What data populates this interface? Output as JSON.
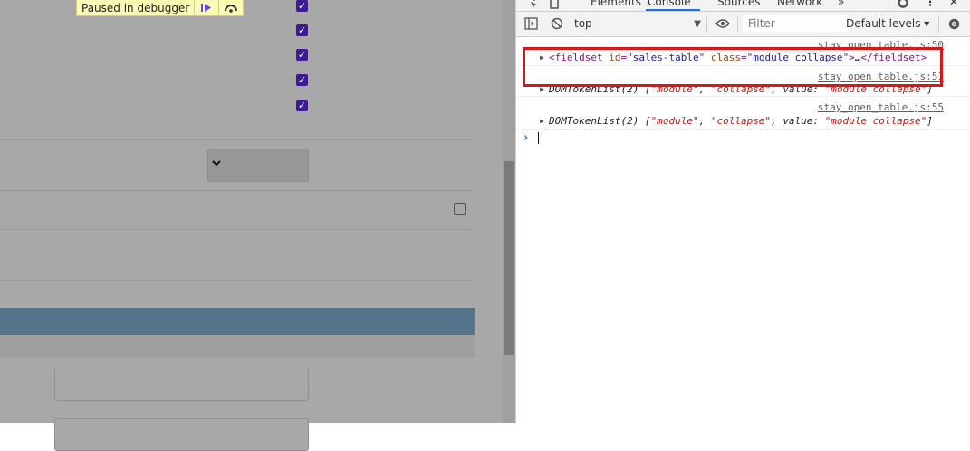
{
  "debugger_banner": {
    "text": "Paused in debugger"
  },
  "devtools": {
    "tabs": [
      "Elements",
      "Console",
      "Sources",
      "Network",
      "»"
    ],
    "active_tab": "Console",
    "context": "top",
    "filter_placeholder": "Filter",
    "levels": "Default levels ▾",
    "logs": [
      {
        "source": "stay_open_table.js:50"
      },
      {
        "source": "stay_open_table.js:51"
      },
      {
        "source": "stay_open_table.js:55"
      }
    ],
    "fieldset": {
      "tag": "fieldset",
      "id_attr": "id",
      "id_val": "sales-table",
      "class_attr": "class",
      "class_val": "module collapse",
      "ellipsis": "…",
      "close_tag": "</fieldset>"
    },
    "tokenlist": {
      "label": "DOMTokenList(2) [",
      "item1": "\"module\"",
      "item2": "\"collapse\"",
      "value_key": "value:",
      "value_val": "\"module collapse\"",
      "close": "]"
    },
    "prompt_symbol": "›"
  },
  "colors": {
    "highlight": "#d71818",
    "accent": "#1a73e8",
    "page_blue_bar": "#537489"
  }
}
